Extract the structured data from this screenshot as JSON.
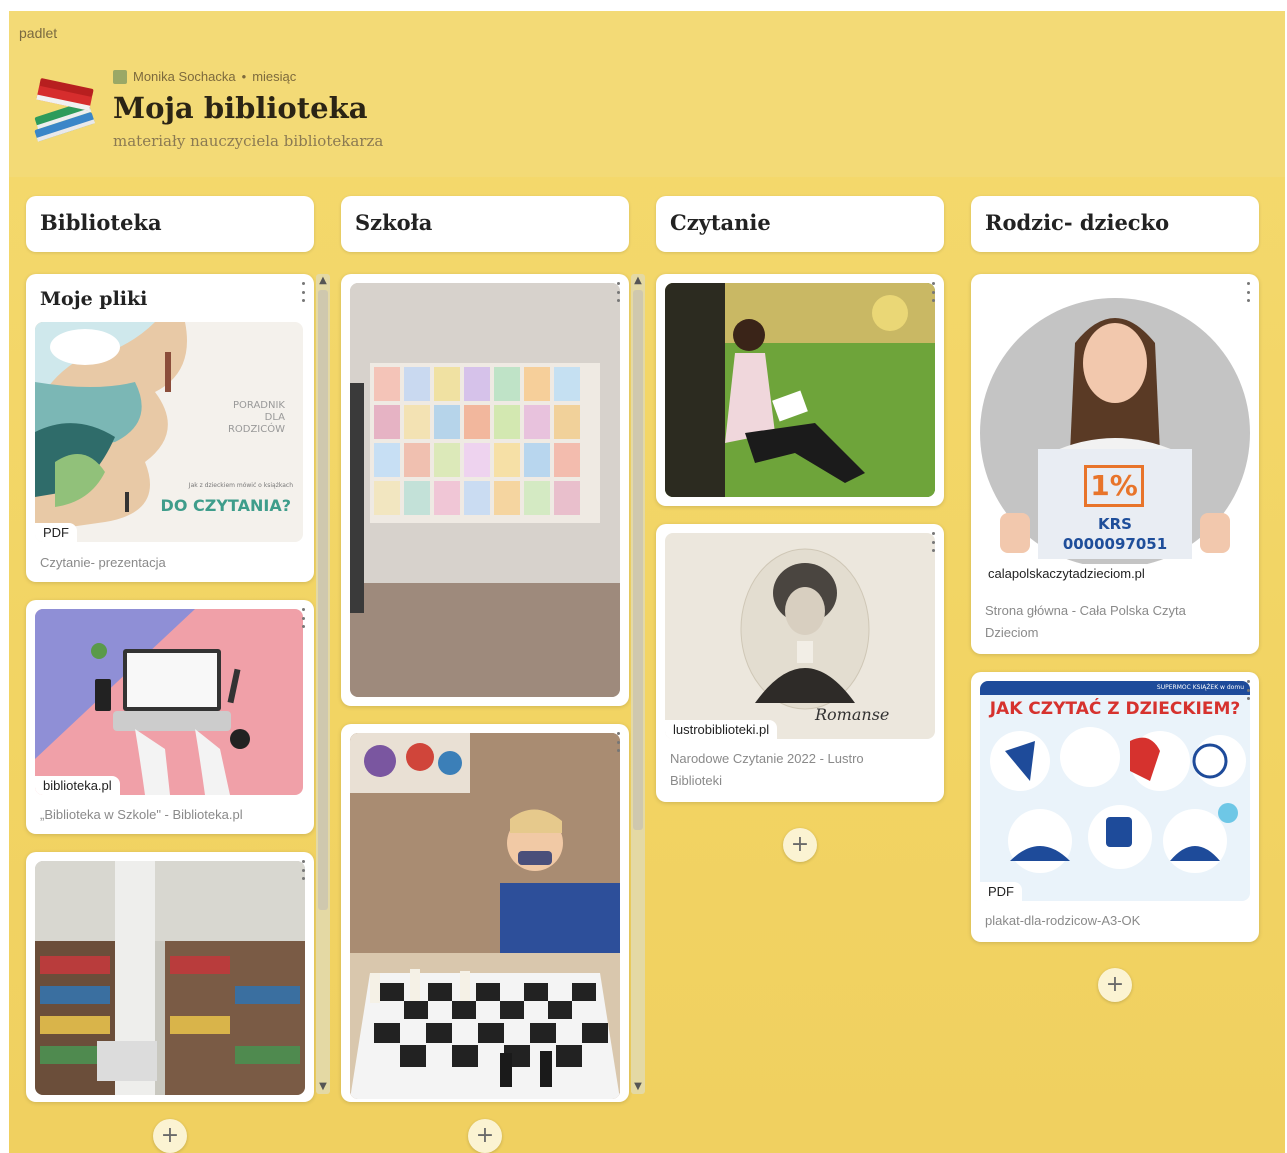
{
  "app": {
    "brand": "padlet"
  },
  "board": {
    "author": "Monika Sochacka",
    "separator": "•",
    "updated": "miesiąc",
    "title": "Moja biblioteka",
    "subtitle": "materiały nauczyciela bibliotekarza",
    "background_color": "#f4d96a"
  },
  "columns": [
    {
      "title": "Biblioteka",
      "cards": [
        {
          "title": "Moje pliki",
          "badge": "PDF",
          "image_text_1": "PORADNIK DLA RODZICÓW",
          "image_text_2": "Jak z dzieckiem mówić o książkach",
          "image_text_3": "DO CZYTANIA?",
          "caption": "Czytanie- prezentacja"
        },
        {
          "tag": "biblioteka.pl",
          "caption": "„Biblioteka w Szkole\" - Biblioteka.pl"
        },
        {
          "image": "library-shelves"
        }
      ]
    },
    {
      "title": "Szkoła",
      "cards": [
        {
          "image": "drawings-on-wall"
        },
        {
          "image": "child-playing-chess"
        }
      ]
    },
    {
      "title": "Czytanie",
      "cards": [
        {
          "image": "woman-reading-in-grass"
        },
        {
          "tag": "lustrobiblioteki.pl",
          "image_text": "Romanse",
          "caption": "Narodowe Czytanie 2022 - Lustro Biblioteki"
        }
      ]
    },
    {
      "title": "Rodzic- dziecko",
      "cards": [
        {
          "tag": "calapolskaczytadzieciom.pl",
          "sign_percent": "1%",
          "sign_krs": "KRS",
          "sign_number": "0000097051",
          "caption": "Strona główna - Cała Polska Czyta Dzieciom"
        },
        {
          "badge": "PDF",
          "poster_title": "JAK CZYTAĆ Z DZIECKIEM?",
          "poster_header": "SUPERMOC KSIĄŻEK w domu",
          "caption": "plakat-dla-rodzicow-A3-OK"
        }
      ]
    }
  ],
  "add_label": "+"
}
